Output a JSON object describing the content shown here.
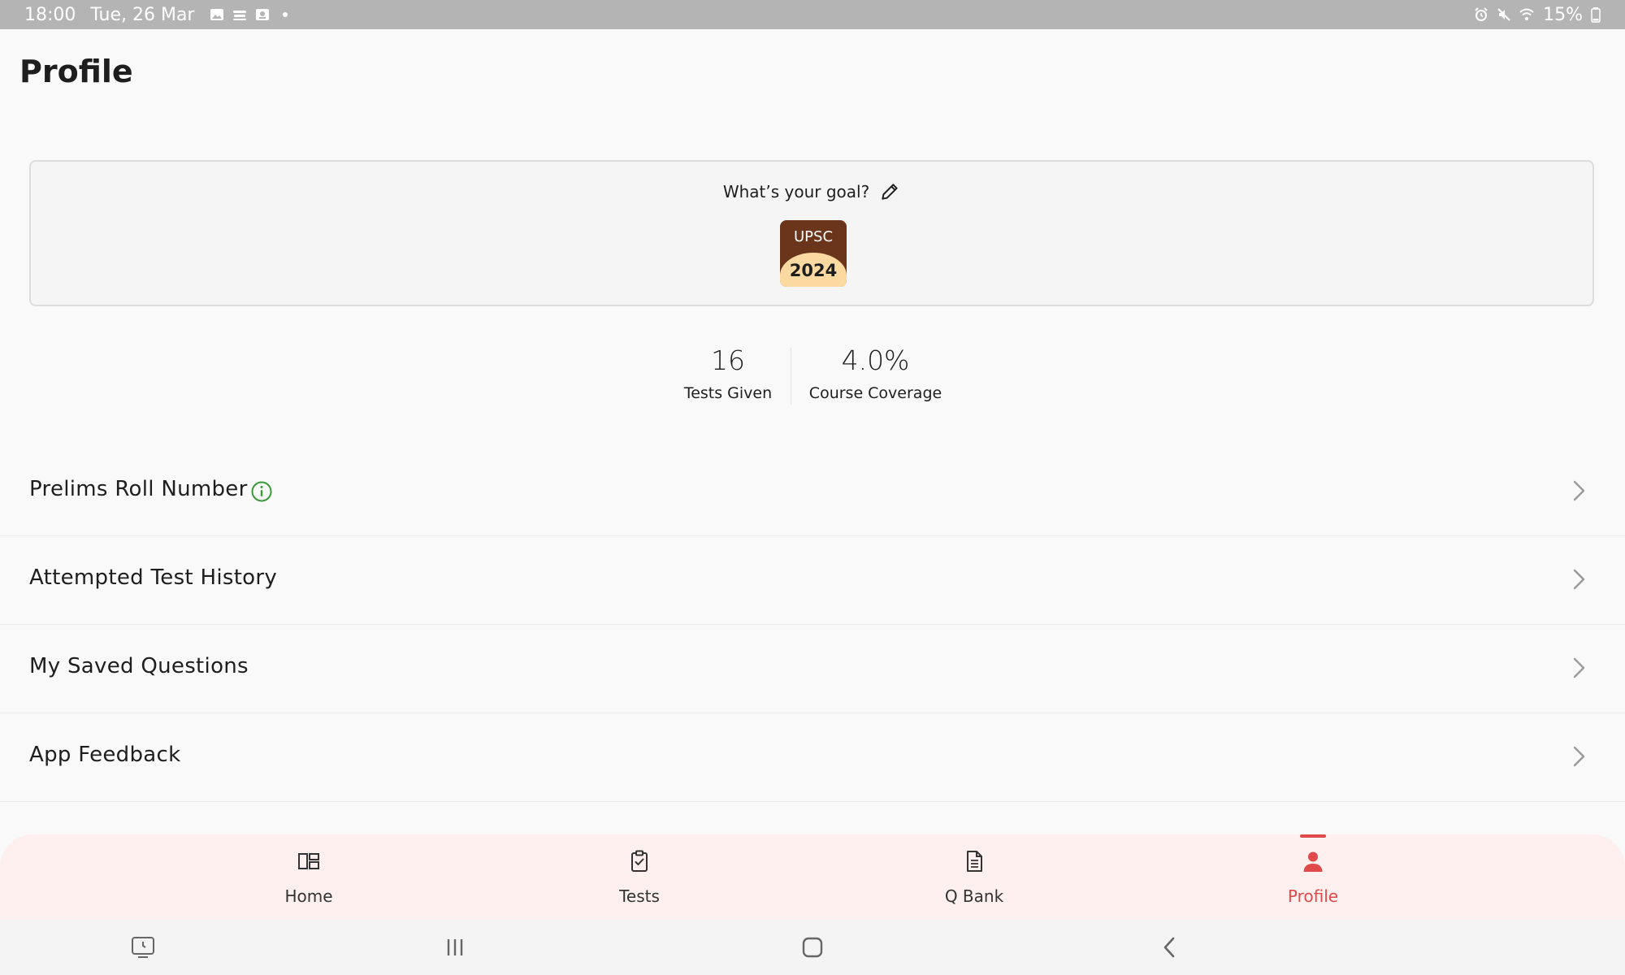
{
  "status_bar": {
    "time": "18:00",
    "date": "Tue, 26 Mar",
    "battery": "15%",
    "left_icons": [
      "gallery-icon",
      "cloud-icon",
      "photo-icon",
      "dot-icon"
    ],
    "right_icons": [
      "alarm-icon",
      "mute-icon",
      "wifi-icon",
      "battery-icon"
    ]
  },
  "page": {
    "title": "Profile"
  },
  "goal": {
    "prompt": "What’s your goal?",
    "badge_top": "UPSC",
    "badge_year": "2024"
  },
  "stats": [
    {
      "value": "16",
      "label": "Tests Given"
    },
    {
      "value": "4.0%",
      "label": "Course Coverage"
    }
  ],
  "menu": {
    "items": [
      {
        "label": "Prelims Roll Number",
        "icon": "info-icon"
      },
      {
        "label": "Attempted Test History"
      },
      {
        "label": "My Saved Questions"
      },
      {
        "label": "App Feedback"
      }
    ]
  },
  "nav": {
    "active_color": "#e04a4a",
    "items": [
      {
        "label": "Home",
        "icon": "dashboard-icon"
      },
      {
        "label": "Tests",
        "icon": "clipboard-check-icon"
      },
      {
        "label": "Q Bank",
        "icon": "document-icon"
      },
      {
        "label": "Profile",
        "icon": "person-icon",
        "active": true
      }
    ]
  },
  "system_nav": [
    "recent-apps-screen-icon",
    "recents-icon",
    "home-icon",
    "back-icon"
  ]
}
